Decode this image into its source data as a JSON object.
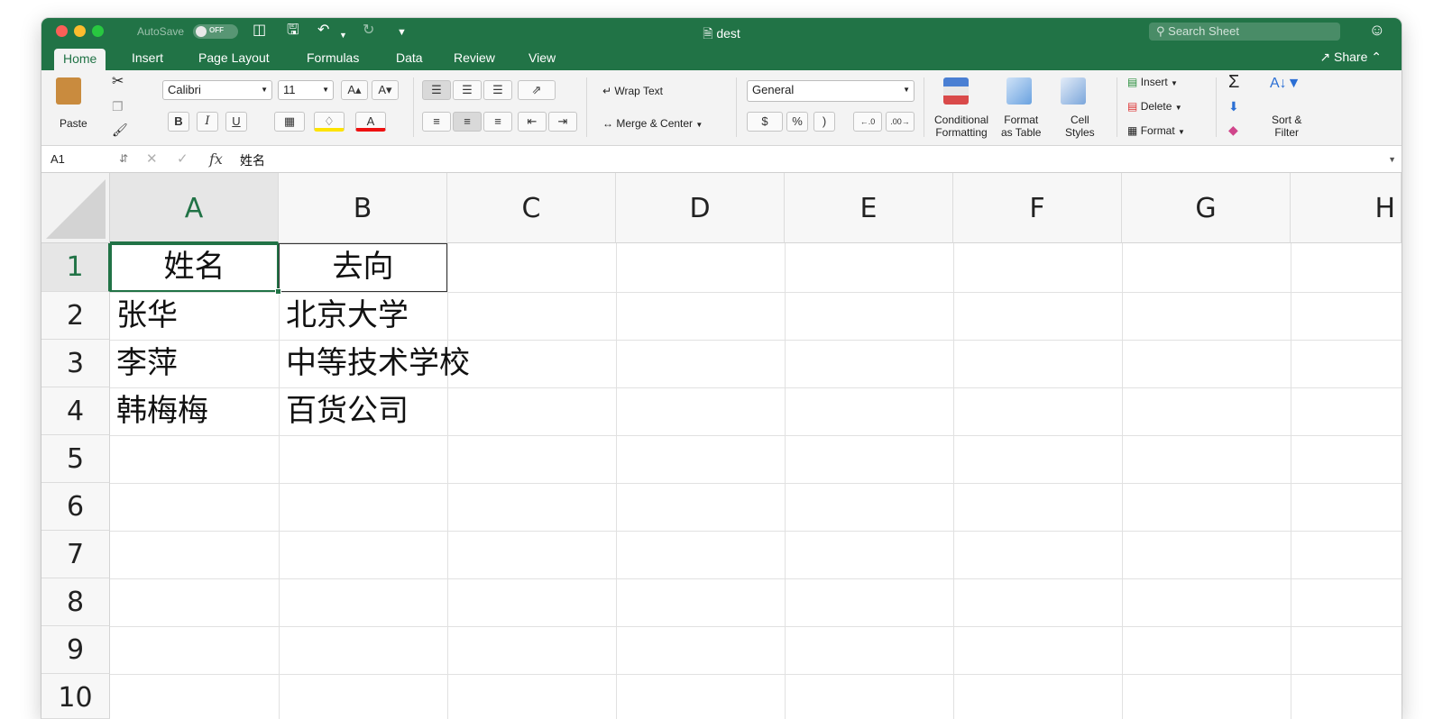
{
  "titlebar": {
    "autosave_label": "AutoSave",
    "autosave_state": "OFF",
    "doc_title": "dest",
    "search_placeholder": "Search Sheet"
  },
  "tabs": [
    {
      "label": "Home",
      "active": true
    },
    {
      "label": "Insert"
    },
    {
      "label": "Page Layout"
    },
    {
      "label": "Formulas"
    },
    {
      "label": "Data"
    },
    {
      "label": "Review"
    },
    {
      "label": "View"
    }
  ],
  "share_label": "Share",
  "ribbon": {
    "paste_label": "Paste",
    "font_name": "Calibri",
    "font_size": "11",
    "bold": "B",
    "italic": "I",
    "underline": "U",
    "wrap_text": "Wrap Text",
    "merge_center": "Merge & Center",
    "number_format": "General",
    "currency": "$",
    "percent": "%",
    "comma": ")",
    "conditional_formatting": [
      "Conditional",
      "Formatting"
    ],
    "format_as_table": [
      "Format",
      "as Table"
    ],
    "cell_styles": [
      "Cell",
      "Styles"
    ],
    "insert": "Insert",
    "delete": "Delete",
    "format": "Format",
    "sort_filter": [
      "Sort &",
      "Filter"
    ]
  },
  "formula_bar": {
    "name_box": "A1",
    "fx": "fx",
    "content": "姓名"
  },
  "sheet": {
    "columns": [
      "A",
      "B",
      "C",
      "D",
      "E",
      "F",
      "G",
      "H"
    ],
    "rows": [
      "1",
      "2",
      "3",
      "4",
      "5",
      "6",
      "7",
      "8",
      "9",
      "10"
    ],
    "cells": {
      "A1": "姓名",
      "B1": "去向",
      "A2": "张华",
      "B2": "北京大学",
      "A3": "李萍",
      "B3": "中等技术学校",
      "A4": "韩梅梅",
      "B4": "百货公司"
    },
    "selected_cell": "A1"
  },
  "colors": {
    "excel_green": "#217346",
    "ribbon_bg": "#f3f3f3"
  }
}
